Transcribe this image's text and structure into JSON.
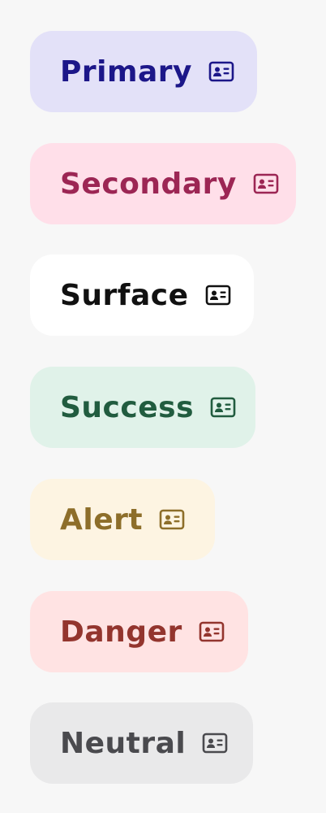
{
  "chips": [
    {
      "label": "Primary",
      "icon": "id-card-icon",
      "text_color": "#1c1789",
      "bg_color": "#e3e1f8"
    },
    {
      "label": "Secondary",
      "icon": "id-card-icon",
      "text_color": "#9c2654",
      "bg_color": "#ffdfe9"
    },
    {
      "label": "Surface",
      "icon": "id-card-icon",
      "text_color": "#111111",
      "bg_color": "#ffffff"
    },
    {
      "label": "Success",
      "icon": "id-card-icon",
      "text_color": "#215c3f",
      "bg_color": "#e0f2e9"
    },
    {
      "label": "Alert",
      "icon": "id-card-icon",
      "text_color": "#8d6e2a",
      "bg_color": "#fdf4e2"
    },
    {
      "label": "Danger",
      "icon": "id-card-icon",
      "text_color": "#93352e",
      "bg_color": "#ffe3e3"
    },
    {
      "label": "Neutral",
      "icon": "id-card-icon",
      "text_color": "#4a4a4e",
      "bg_color": "#e9e9ea"
    }
  ]
}
